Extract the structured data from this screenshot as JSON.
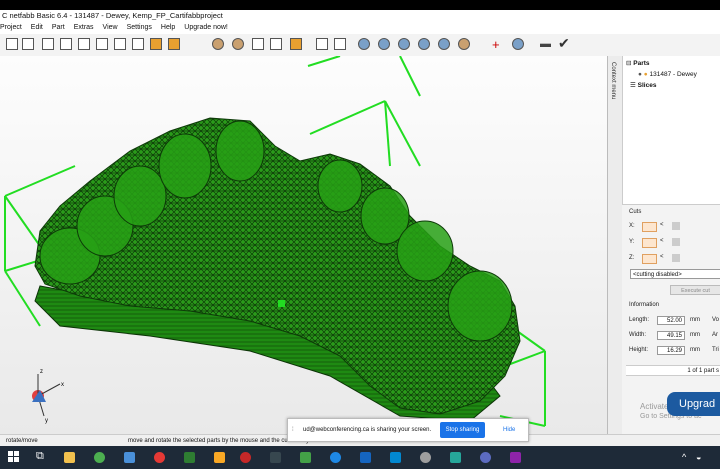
{
  "window": {
    "title": "C netfabb Basic 6.4 - 131487 - Dewey, Kemp_FP_Cartifabbproject"
  },
  "menu": [
    "Project",
    "Edit",
    "Part",
    "Extras",
    "View",
    "Settings",
    "Help",
    "Upgrade now!"
  ],
  "right_panel": {
    "vertical_tab": "Context menu",
    "tree": {
      "root": "Parts",
      "part": "131487 - Dewey",
      "slices": "Slices"
    },
    "cuts": {
      "title": "Cuts",
      "axes": [
        "X:",
        "Y:",
        "Z:"
      ],
      "cut_symbol": "<",
      "dropdown": "<cutting disabled>",
      "execute_button": "Execute cut"
    },
    "information": {
      "title": "Information",
      "length_label": "Length:",
      "length_value": "52.00",
      "length_unit": "mm",
      "length_extra": "Vo",
      "width_label": "Width:",
      "width_value": "49.15",
      "width_unit": "mm",
      "width_extra": "Ar",
      "height_label": "Height:",
      "height_value": "16.29",
      "height_unit": "mm",
      "height_extra": "Tri",
      "parts_count": "1 of 1 part s"
    }
  },
  "status": {
    "mode": "rotate/move",
    "message": "move and rotate the selected parts by the mouse and the cursor keys"
  },
  "share": {
    "message": "ud@webconferencing.ca is sharing your screen.",
    "stop_label": "Stop sharing",
    "hide_label": "Hide"
  },
  "overlay": {
    "upgrade": "Upgrad",
    "activate_line1": "Activate W",
    "activate_line2": "Go to Settings to ac"
  },
  "axis_labels": {
    "x": "x",
    "y": "y",
    "z": "z"
  },
  "colors": {
    "mesh": "#2a9a1a",
    "bbox": "#22dd22",
    "accent": "#1a73e8"
  }
}
